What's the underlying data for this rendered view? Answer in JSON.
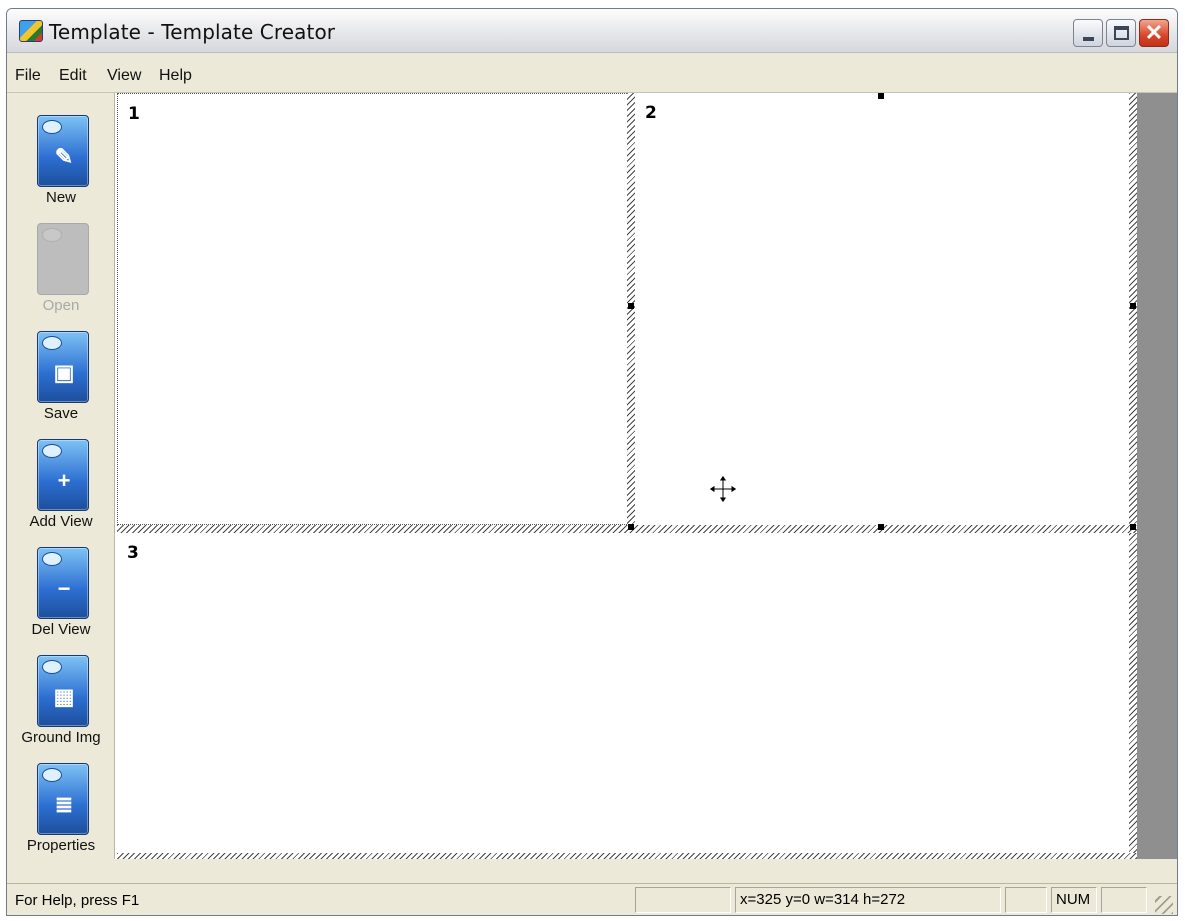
{
  "window": {
    "title": "Template - Template Creator",
    "controls": {
      "minimize": "minimize",
      "maximize": "maximize",
      "close": "✕"
    }
  },
  "menu": {
    "items": [
      "File",
      "Edit",
      "View",
      "Help"
    ]
  },
  "toolbar": {
    "items": [
      {
        "label": "New",
        "icon": "new-document-icon",
        "enabled": true,
        "glyph": "✎"
      },
      {
        "label": "Open",
        "icon": "open-folder-icon",
        "enabled": false,
        "glyph": ""
      },
      {
        "label": "Save",
        "icon": "save-disk-icon",
        "enabled": true,
        "glyph": "▣"
      },
      {
        "label": "Add View",
        "icon": "add-view-icon",
        "enabled": true,
        "glyph": "+"
      },
      {
        "label": "Del View",
        "icon": "delete-view-icon",
        "enabled": true,
        "glyph": "−"
      },
      {
        "label": "Ground Img",
        "icon": "ground-image-icon",
        "enabled": true,
        "glyph": "▦"
      },
      {
        "label": "Properties",
        "icon": "properties-icon",
        "enabled": true,
        "glyph": "≣"
      }
    ]
  },
  "canvas": {
    "panes": [
      {
        "number": "1"
      },
      {
        "number": "2"
      },
      {
        "number": "3"
      }
    ]
  },
  "status": {
    "help_text": "For Help, press F1",
    "empty_cell": "",
    "coords": "x=325 y=0 w=314 h=272",
    "indicator_blank": "",
    "num_lock": "NUM",
    "indicator_blank2": ""
  },
  "colors": {
    "accent": "#2c6ed1",
    "chrome": "#ece9d8",
    "workspace_bg": "#8f8f8f",
    "close_button": "#d7462a"
  }
}
